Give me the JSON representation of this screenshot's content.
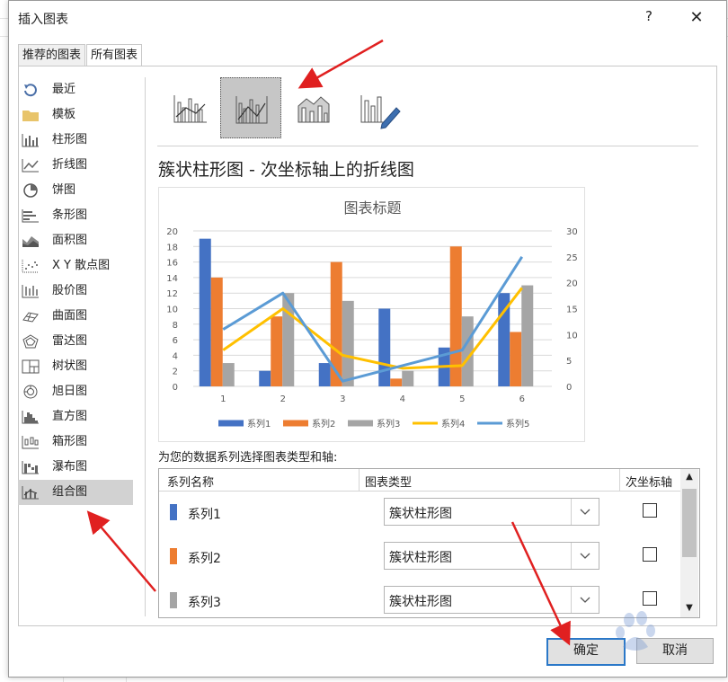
{
  "window": {
    "title": "插入图表",
    "help_label": "?",
    "close_label": "✕"
  },
  "tabs": [
    {
      "label": "推荐的图表"
    },
    {
      "label": "所有图表"
    }
  ],
  "sidebar": {
    "items": [
      {
        "label": "最近",
        "icon": "recent-icon"
      },
      {
        "label": "模板",
        "icon": "folder-icon"
      },
      {
        "label": "柱形图",
        "icon": "column-chart-icon"
      },
      {
        "label": "折线图",
        "icon": "line-chart-icon"
      },
      {
        "label": "饼图",
        "icon": "pie-chart-icon"
      },
      {
        "label": "条形图",
        "icon": "bar-chart-icon"
      },
      {
        "label": "面积图",
        "icon": "area-chart-icon"
      },
      {
        "label": "X Y 散点图",
        "icon": "scatter-chart-icon"
      },
      {
        "label": "股价图",
        "icon": "stock-chart-icon"
      },
      {
        "label": "曲面图",
        "icon": "surface-chart-icon"
      },
      {
        "label": "雷达图",
        "icon": "radar-chart-icon"
      },
      {
        "label": "树状图",
        "icon": "treemap-chart-icon"
      },
      {
        "label": "旭日图",
        "icon": "sunburst-chart-icon"
      },
      {
        "label": "直方图",
        "icon": "histogram-chart-icon"
      },
      {
        "label": "箱形图",
        "icon": "boxplot-chart-icon"
      },
      {
        "label": "瀑布图",
        "icon": "waterfall-chart-icon"
      },
      {
        "label": "组合图",
        "icon": "combo-chart-icon"
      }
    ],
    "selected_index": 16
  },
  "subtypes": {
    "items": [
      {
        "icon": "clustered-column-line-icon"
      },
      {
        "icon": "clustered-column-line-secondary-axis-icon"
      },
      {
        "icon": "stacked-area-clustered-column-icon"
      },
      {
        "icon": "custom-combination-icon"
      }
    ],
    "selected_index": 1
  },
  "chart_heading": "簇状柱形图 - 次坐标轴上的折线图",
  "chart_data": {
    "type": "bar",
    "title": "图表标题",
    "categories": [
      "1",
      "2",
      "3",
      "4",
      "5",
      "6"
    ],
    "ylim": [
      0,
      20
    ],
    "y_ticks": [
      "0",
      "2",
      "4",
      "6",
      "8",
      "10",
      "12",
      "14",
      "16",
      "18",
      "20"
    ],
    "y2lim": [
      0,
      30
    ],
    "y2_ticks": [
      "0",
      "5",
      "10",
      "15",
      "20",
      "25",
      "30"
    ],
    "grid": true,
    "legend_position": "bottom",
    "series": [
      {
        "name": "系列1",
        "kind": "bar",
        "axis": "primary",
        "color": "#4472c4",
        "values": [
          19,
          2,
          3,
          10,
          5,
          12
        ]
      },
      {
        "name": "系列2",
        "kind": "bar",
        "axis": "primary",
        "color": "#ed7d31",
        "values": [
          14,
          9,
          16,
          1,
          18,
          7
        ]
      },
      {
        "name": "系列3",
        "kind": "bar",
        "axis": "primary",
        "color": "#a5a5a5",
        "values": [
          3,
          12,
          11,
          2,
          9,
          13
        ]
      },
      {
        "name": "系列4",
        "kind": "line",
        "axis": "secondary",
        "color": "#ffc000",
        "values": [
          7,
          15,
          6,
          3.5,
          4,
          19
        ]
      },
      {
        "name": "系列5",
        "kind": "line",
        "axis": "secondary",
        "color": "#5b9bd5",
        "values": [
          11,
          18,
          1,
          4,
          7,
          25
        ]
      }
    ]
  },
  "series_section": {
    "label": "为您的数据系列选择图表类型和轴:",
    "headers": {
      "name": "系列名称",
      "type": "图表类型",
      "secondary_axis": "次坐标轴"
    },
    "rows": [
      {
        "name": "系列1",
        "color": "#4472c4",
        "chart_type": "簇状柱形图",
        "secondary_axis": false
      },
      {
        "name": "系列2",
        "color": "#ed7d31",
        "chart_type": "簇状柱形图",
        "secondary_axis": false
      },
      {
        "name": "系列3",
        "color": "#a5a5a5",
        "chart_type": "簇状柱形图",
        "secondary_axis": false
      }
    ]
  },
  "buttons": {
    "ok": "确定",
    "cancel": "取消"
  },
  "annotation_color": "#e02020"
}
